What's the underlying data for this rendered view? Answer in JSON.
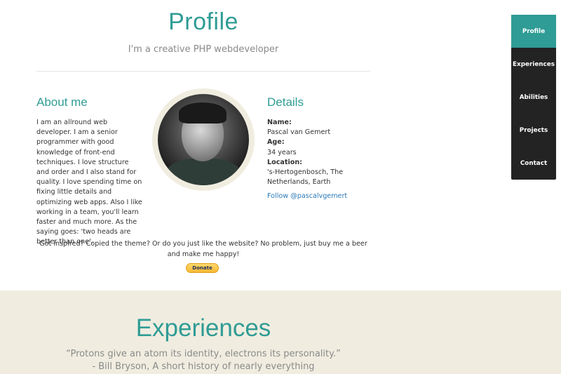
{
  "header": {
    "title": "Profile",
    "subtitle": "I'm a creative PHP webdeveloper"
  },
  "about": {
    "title": "About me",
    "text": "I am an allround web developer. I am a senior programmer with good knowledge of front-end techniques. I love structure and order and I also stand for quality. I love spending time on fixing little details and optimizing web apps. Also I like working in a team, you'll learn faster and much more. As the saying goes: 'two heads are better than one'."
  },
  "details": {
    "title": "Details",
    "name_label": "Name:",
    "name_value": "Pascal van Gemert",
    "age_label": "Age:",
    "age_value": "34 years",
    "location_label": "Location:",
    "location_value": "'s-Hertogenbosch, The Netherlands, Earth",
    "follow_link": "Follow @pascalvgemert"
  },
  "donate": {
    "message": "Got inspired? Copied the theme? Or do you just like the website? No problem, just buy me a beer and make me happy!",
    "button_label": "Donate"
  },
  "experiences": {
    "title": "Experiences",
    "quote": "“Protons give an atom its identity, electrons its personality.”",
    "author": "- Bill Bryson, A short history of nearly everything"
  },
  "nav": {
    "items": [
      {
        "label": "Profile"
      },
      {
        "label": "Experiences"
      },
      {
        "label": "Abilities"
      },
      {
        "label": "Projects"
      },
      {
        "label": "Contact"
      }
    ],
    "active_index": 0
  },
  "colors": {
    "accent": "#2f9c95",
    "nav_bg": "#232323",
    "section_bg": "#f0ede0",
    "link": "#2a7ab8"
  }
}
